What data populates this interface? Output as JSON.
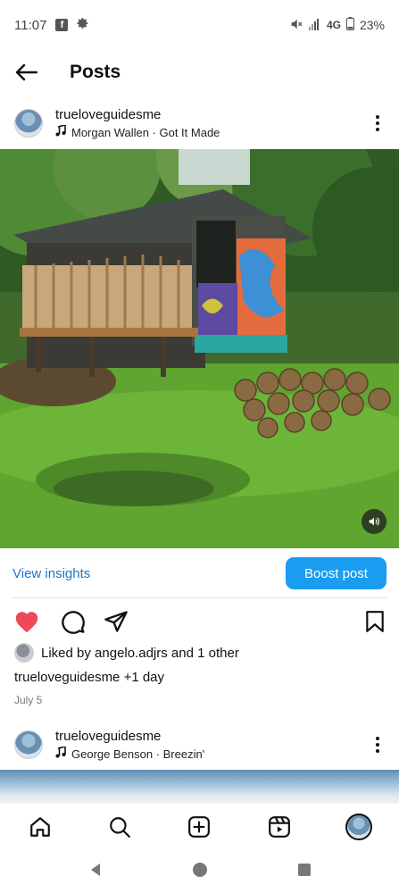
{
  "status_bar": {
    "time": "11:07",
    "notif_badge": "f",
    "network": "4G",
    "battery": "23%"
  },
  "header": {
    "title": "Posts"
  },
  "post1": {
    "username": "trueloveguidesme",
    "song": "Morgan Wallen · Got It Made",
    "insights_label": "View insights",
    "boost_label": "Boost post",
    "likes_text": "Liked by angelo.adjrs and 1 other",
    "caption": "trueloveguidesme +1 day",
    "date": "July 5",
    "liked": true,
    "like_color": "#ed4956"
  },
  "post2": {
    "username": "trueloveguidesme",
    "song": "George Benson · Breezin'"
  },
  "bottom_nav": {
    "items": [
      "home-icon",
      "search-icon",
      "create-icon",
      "reels-icon",
      "profile-avatar"
    ]
  },
  "colors": {
    "accent": "#1a9cf0",
    "link": "#1877c9"
  }
}
